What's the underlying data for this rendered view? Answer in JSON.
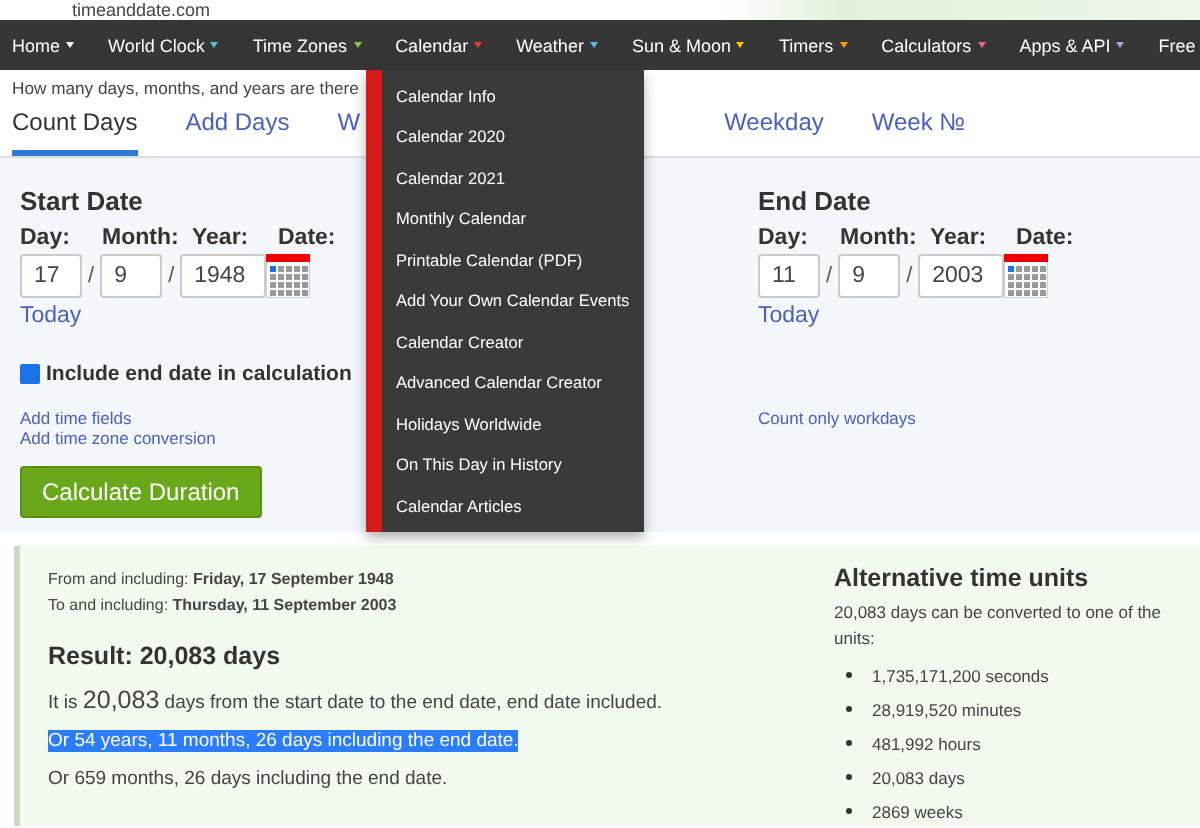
{
  "logo": "timeanddate.com",
  "nav": [
    {
      "label": "Home",
      "color": "#ffffff"
    },
    {
      "label": "World Clock",
      "color": "#5bc0de"
    },
    {
      "label": "Time Zones",
      "color": "#8bc34a"
    },
    {
      "label": "Calendar",
      "color": "#e53935"
    },
    {
      "label": "Weather",
      "color": "#5bc0de"
    },
    {
      "label": "Sun & Moon",
      "color": "#ffc107"
    },
    {
      "label": "Timers",
      "color": "#ff9800"
    },
    {
      "label": "Calculators",
      "color": "#f06292"
    },
    {
      "label": "Apps & API",
      "color": "#b39ddb"
    }
  ],
  "nav_cut": "Free",
  "dropdown": [
    "Calendar Info",
    "Calendar 2020",
    "Calendar 2021",
    "Monthly Calendar",
    "Printable Calendar (PDF)",
    "Add Your Own Calendar Events",
    "Calendar Creator",
    "Advanced Calendar Creator",
    "Holidays Worldwide",
    "On This Day in History",
    "Calendar Articles"
  ],
  "intro": "How many days, months, and years are there",
  "tabs": [
    {
      "label": "Count Days",
      "selected": true
    },
    {
      "label": "Add Days",
      "selected": false
    },
    {
      "label": "W",
      "selected": false
    },
    {
      "label": "Weekday",
      "selected": false
    },
    {
      "label": "Week №",
      "selected": false
    }
  ],
  "start": {
    "title": "Start Date",
    "day_label": "Day:",
    "month_label": "Month:",
    "year_label": "Year:",
    "date_label": "Date:",
    "day": "17",
    "month": "9",
    "year": "1948",
    "sep": "/",
    "today": "Today"
  },
  "end": {
    "title": "End Date",
    "day_label": "Day:",
    "month_label": "Month:",
    "year_label": "Year:",
    "date_label": "Date:",
    "day": "11",
    "month": "9",
    "year": "2003",
    "sep": "/",
    "today": "Today"
  },
  "include_end": {
    "label": "Include end date in calculation",
    "checked": true
  },
  "links_left": [
    "Add time fields",
    "Add time zone conversion"
  ],
  "link_right": "Count only workdays",
  "calculate": "Calculate Duration",
  "result": {
    "from": "From and including: **Friday, 17 September 1948**",
    "to": "To and including: **Thursday, 11 September 2003**",
    "title": "Result: 20,083 days",
    "lines": [
      {
        "pre": "It is",
        "big": "20,083",
        "post": "days from the start date to the end date, end date included.",
        "selected": false
      },
      {
        "pre": "Or 54 years, 11 months, 26 days including the end date.",
        "selected": true
      },
      {
        "pre": "Or 659 months, 26 days including the end date.",
        "selected": false
      }
    ]
  },
  "alt": {
    "title": "Alternative time units",
    "text": "20,083 days can be converted to one of the",
    "text2": "units:",
    "items": [
      "1,735,171,200 seconds",
      "28,919,520 minutes",
      "481,992 hours",
      "20,083 days",
      "2869 weeks"
    ]
  }
}
